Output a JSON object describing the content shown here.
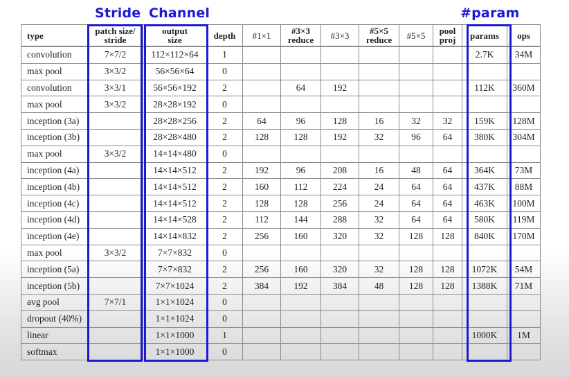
{
  "annotations": {
    "stride": "Stride",
    "channel": "Channel",
    "param": "#param"
  },
  "accent_color": "#1a1ad6",
  "table": {
    "headers": [
      {
        "key": "type",
        "line1": "type",
        "line2": ""
      },
      {
        "key": "patch",
        "line1": "patch size/",
        "line2": "stride"
      },
      {
        "key": "output",
        "line1": "output",
        "line2": "size"
      },
      {
        "key": "depth",
        "line1": "depth",
        "line2": ""
      },
      {
        "key": "n1x1",
        "line1": "#1×1",
        "line2": ""
      },
      {
        "key": "n3x3r",
        "line1": "#3×3",
        "line2": "reduce"
      },
      {
        "key": "n3x3",
        "line1": "#3×3",
        "line2": ""
      },
      {
        "key": "n5x5r",
        "line1": "#5×5",
        "line2": "reduce"
      },
      {
        "key": "n5x5",
        "line1": "#5×5",
        "line2": ""
      },
      {
        "key": "pool",
        "line1": "pool",
        "line2": "proj"
      },
      {
        "key": "params",
        "line1": "params",
        "line2": ""
      },
      {
        "key": "ops",
        "line1": "ops",
        "line2": ""
      }
    ],
    "rows": [
      [
        "convolution",
        "7×7/2",
        "112×112×64",
        "1",
        "",
        "",
        "",
        "",
        "",
        "",
        "2.7K",
        "34M"
      ],
      [
        "max pool",
        "3×3/2",
        "56×56×64",
        "0",
        "",
        "",
        "",
        "",
        "",
        "",
        "",
        ""
      ],
      [
        "convolution",
        "3×3/1",
        "56×56×192",
        "2",
        "",
        "64",
        "192",
        "",
        "",
        "",
        "112K",
        "360M"
      ],
      [
        "max pool",
        "3×3/2",
        "28×28×192",
        "0",
        "",
        "",
        "",
        "",
        "",
        "",
        "",
        ""
      ],
      [
        "inception (3a)",
        "",
        "28×28×256",
        "2",
        "64",
        "96",
        "128",
        "16",
        "32",
        "32",
        "159K",
        "128M"
      ],
      [
        "inception (3b)",
        "",
        "28×28×480",
        "2",
        "128",
        "128",
        "192",
        "32",
        "96",
        "64",
        "380K",
        "304M"
      ],
      [
        "max pool",
        "3×3/2",
        "14×14×480",
        "0",
        "",
        "",
        "",
        "",
        "",
        "",
        "",
        ""
      ],
      [
        "inception (4a)",
        "",
        "14×14×512",
        "2",
        "192",
        "96",
        "208",
        "16",
        "48",
        "64",
        "364K",
        "73M"
      ],
      [
        "inception (4b)",
        "",
        "14×14×512",
        "2",
        "160",
        "112",
        "224",
        "24",
        "64",
        "64",
        "437K",
        "88M"
      ],
      [
        "inception (4c)",
        "",
        "14×14×512",
        "2",
        "128",
        "128",
        "256",
        "24",
        "64",
        "64",
        "463K",
        "100M"
      ],
      [
        "inception (4d)",
        "",
        "14×14×528",
        "2",
        "112",
        "144",
        "288",
        "32",
        "64",
        "64",
        "580K",
        "119M"
      ],
      [
        "inception (4e)",
        "",
        "14×14×832",
        "2",
        "256",
        "160",
        "320",
        "32",
        "128",
        "128",
        "840K",
        "170M"
      ],
      [
        "max pool",
        "3×3/2",
        "7×7×832",
        "0",
        "",
        "",
        "",
        "",
        "",
        "",
        "",
        ""
      ],
      [
        "inception (5a)",
        "",
        "7×7×832",
        "2",
        "256",
        "160",
        "320",
        "32",
        "128",
        "128",
        "1072K",
        "54M"
      ],
      [
        "inception (5b)",
        "",
        "7×7×1024",
        "2",
        "384",
        "192",
        "384",
        "48",
        "128",
        "128",
        "1388K",
        "71M"
      ],
      [
        "avg pool",
        "7×7/1",
        "1×1×1024",
        "0",
        "",
        "",
        "",
        "",
        "",
        "",
        "",
        ""
      ],
      [
        "dropout (40%)",
        "",
        "1×1×1024",
        "0",
        "",
        "",
        "",
        "",
        "",
        "",
        "",
        ""
      ],
      [
        "linear",
        "",
        "1×1×1000",
        "1",
        "",
        "",
        "",
        "",
        "",
        "",
        "1000K",
        "1M"
      ],
      [
        "softmax",
        "",
        "1×1×1000",
        "0",
        "",
        "",
        "",
        "",
        "",
        "",
        "",
        ""
      ]
    ]
  }
}
